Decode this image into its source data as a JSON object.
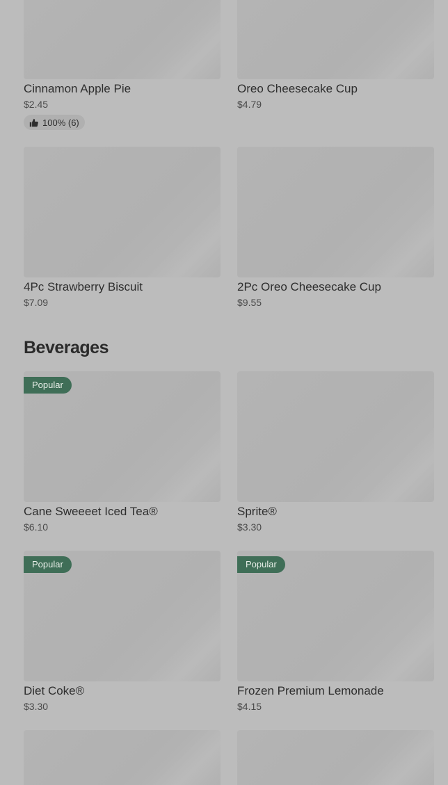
{
  "desserts": [
    {
      "name": "Cinnamon Apple Pie",
      "price": "$2.45",
      "rating": "100% (6)"
    },
    {
      "name": "Oreo Cheesecake Cup",
      "price": "$4.79"
    },
    {
      "name": "4Pc Strawberry Biscuit",
      "price": "$7.09"
    },
    {
      "name": "2Pc Oreo Cheesecake Cup",
      "price": "$9.55"
    }
  ],
  "beverages_title": "Beverages",
  "beverages": [
    {
      "name": "Cane Sweeeet Iced Tea®",
      "price": "$6.10",
      "badge": "Popular"
    },
    {
      "name": "Sprite®",
      "price": "$3.30"
    },
    {
      "name": "Diet Coke®",
      "price": "$3.30",
      "badge": "Popular"
    },
    {
      "name": "Frozen Premium Lemonade",
      "price": "$4.15",
      "badge": "Popular"
    }
  ],
  "icons": {
    "rating": "thumbs-up-icon"
  }
}
